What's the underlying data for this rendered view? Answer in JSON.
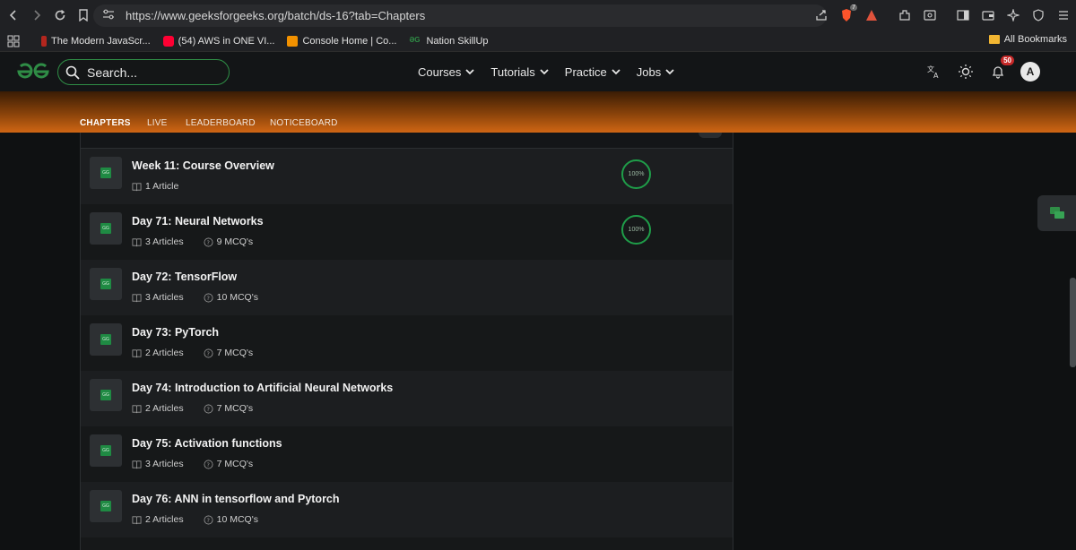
{
  "browser": {
    "url": "https://www.geeksforgeeks.org/batch/ds-16?tab=Chapters",
    "extension_badge": "7"
  },
  "bookmarks": {
    "items": [
      {
        "label": "The Modern JavaScr...",
        "color": "#b3261e"
      },
      {
        "label": "(54) AWS in ONE VI...",
        "color": "#ff0033"
      },
      {
        "label": "Console Home | Co...",
        "color": "#f29100"
      },
      {
        "label": "Nation SkillUp",
        "color": "#2f8d46"
      }
    ],
    "all_label": "All Bookmarks"
  },
  "header": {
    "search_placeholder": "Search...",
    "nav": [
      "Courses",
      "Tutorials",
      "Practice",
      "Jobs"
    ],
    "notification_count": "50",
    "avatar_letter": "A"
  },
  "tabs": {
    "chapters": "CHAPTERS",
    "live": "LIVE",
    "leaderboard": "LEADERBOARD",
    "noticeboard": "NOTICEBOARD"
  },
  "chapters": [
    {
      "title": "Week 11: Course Overview",
      "articles": "1 Article",
      "mcqs": "",
      "progress": "100%"
    },
    {
      "title": "Day 71: Neural Networks",
      "articles": "3 Articles",
      "mcqs": "9 MCQ's",
      "progress": "100%"
    },
    {
      "title": "Day 72: TensorFlow",
      "articles": "3 Articles",
      "mcqs": "10 MCQ's",
      "progress": ""
    },
    {
      "title": "Day 73: PyTorch",
      "articles": "2 Articles",
      "mcqs": "7 MCQ's",
      "progress": ""
    },
    {
      "title": "Day 74: Introduction to Artificial Neural Networks",
      "articles": "2 Articles",
      "mcqs": "7 MCQ's",
      "progress": ""
    },
    {
      "title": "Day 75: Activation functions",
      "articles": "3 Articles",
      "mcqs": "7 MCQ's",
      "progress": ""
    },
    {
      "title": "Day 76: ANN in tensorflow and Pytorch",
      "articles": "2 Articles",
      "mcqs": "10 MCQ's",
      "progress": ""
    }
  ],
  "thumb_label": "GG",
  "colors": {
    "brand_green": "#2f8d46",
    "progress_green": "#1f9d49",
    "banner_orange": "#d06614"
  }
}
